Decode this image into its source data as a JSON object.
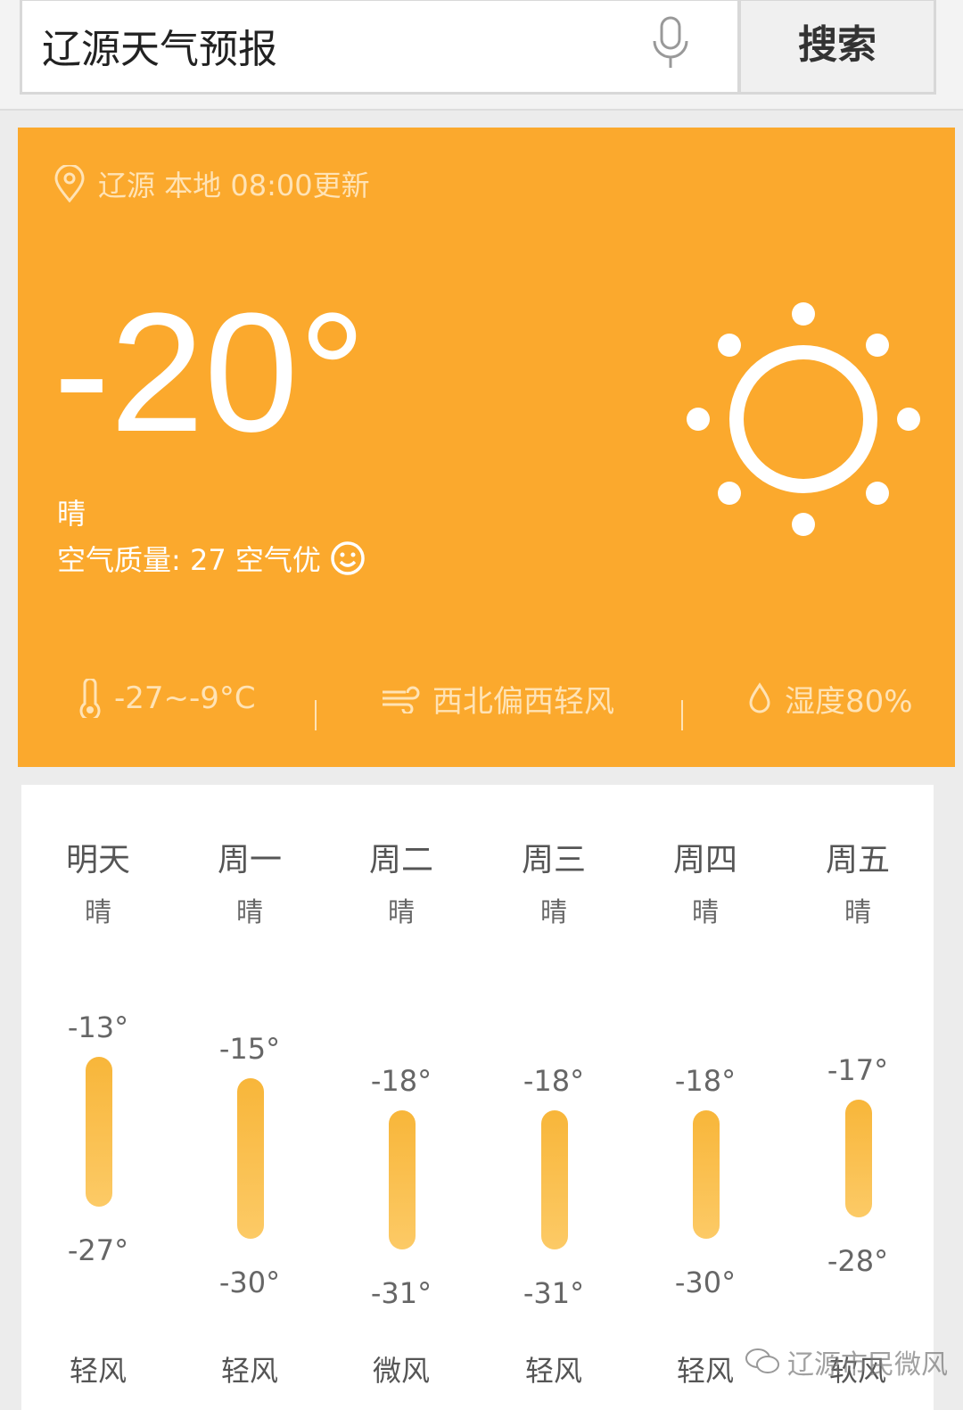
{
  "search": {
    "query": "辽源天气预报",
    "button": "搜索",
    "mic_icon": "microphone-icon"
  },
  "current": {
    "location_line": "辽源 本地 08:00更新",
    "temperature": "-20°",
    "condition": "晴",
    "air_quality": "空气质量: 27 空气优",
    "temp_range": "-27~-9°C",
    "wind": "西北偏西轻风",
    "humidity": "湿度80%",
    "accent": "#fba92d"
  },
  "forecast": [
    {
      "day": "明天",
      "cond": "晴",
      "high": "-13°",
      "low": "-27°",
      "high_v": -13,
      "low_v": -27,
      "wind": "轻风"
    },
    {
      "day": "周一",
      "cond": "晴",
      "high": "-15°",
      "low": "-30°",
      "high_v": -15,
      "low_v": -30,
      "wind": "轻风"
    },
    {
      "day": "周二",
      "cond": "晴",
      "high": "-18°",
      "low": "-31°",
      "high_v": -18,
      "low_v": -31,
      "wind": "微风"
    },
    {
      "day": "周三",
      "cond": "晴",
      "high": "-18°",
      "low": "-31°",
      "high_v": -18,
      "low_v": -31,
      "wind": "轻风"
    },
    {
      "day": "周四",
      "cond": "晴",
      "high": "-18°",
      "low": "-30°",
      "high_v": -18,
      "low_v": -30,
      "wind": "轻风"
    },
    {
      "day": "周五",
      "cond": "晴",
      "high": "-17°",
      "low": "-28°",
      "high_v": -17,
      "low_v": -28,
      "wind": "软风"
    }
  ],
  "watermark": "辽源市民微风"
}
